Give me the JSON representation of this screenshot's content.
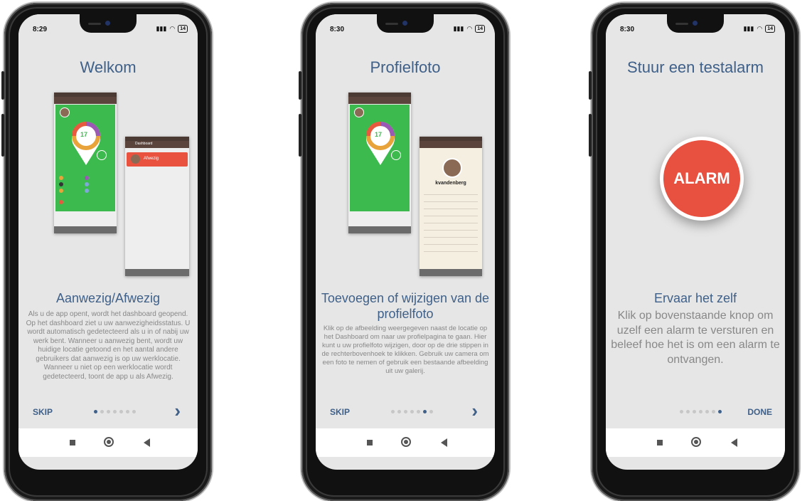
{
  "screens": [
    {
      "time": "8:29",
      "battery": "14",
      "title": "Welkom",
      "subtitle": "Aanwezig/Afwezig",
      "body": "Als u de app opent, wordt het dashboard geopend. Op het dashboard ziet u uw aanwezigheidsstatus. U wordt automatisch gedetecteerd als u in of nabij uw werk bent. Wanneer u aanwezig bent, wordt uw huidige locatie getoond en het aantal andere gebruikers dat aanwezig is op uw werklocatie. Wanneer u niet op een werklocatie wordt gedetecteerd, toont de app u als Afwezig.",
      "skip": "SKIP",
      "next_icon": "chevron-right-icon",
      "dots_active": 0,
      "mini": {
        "header": "Dashboard",
        "count": "17",
        "away_label": "Afwezig"
      }
    },
    {
      "time": "8:30",
      "battery": "14",
      "title": "Profielfoto",
      "subtitle": "Toevoegen of wijzigen van de profielfoto",
      "body": "Klik op de afbeelding weergegeven naast de locatie op het Dashboard om naar uw profielpagina te gaan. Hier kunt u uw profielfoto wijzigen, door op de drie stippen in de rechterbovenhoek te klikken. Gebruik uw camera om een foto te nemen of gebruik een bestaande afbeelding uit uw galerij.",
      "skip": "SKIP",
      "next_icon": "chevron-right-icon",
      "dots_active": 5,
      "mini": {
        "count": "17",
        "username": "kvandenberg"
      }
    },
    {
      "time": "8:30",
      "battery": "14",
      "title": "Stuur een testalarm",
      "alarm_label": "ALARM",
      "subtitle": "Ervaar het zelf",
      "body": "Klik op bovenstaande knop om uzelf een alarm te versturen en beleef hoe het is om een alarm te ontvangen.",
      "done": "DONE",
      "dots_active": 6
    }
  ],
  "colors": {
    "accent": "#3f6089",
    "alarm": "#e8503f",
    "green": "#3dba4e"
  }
}
